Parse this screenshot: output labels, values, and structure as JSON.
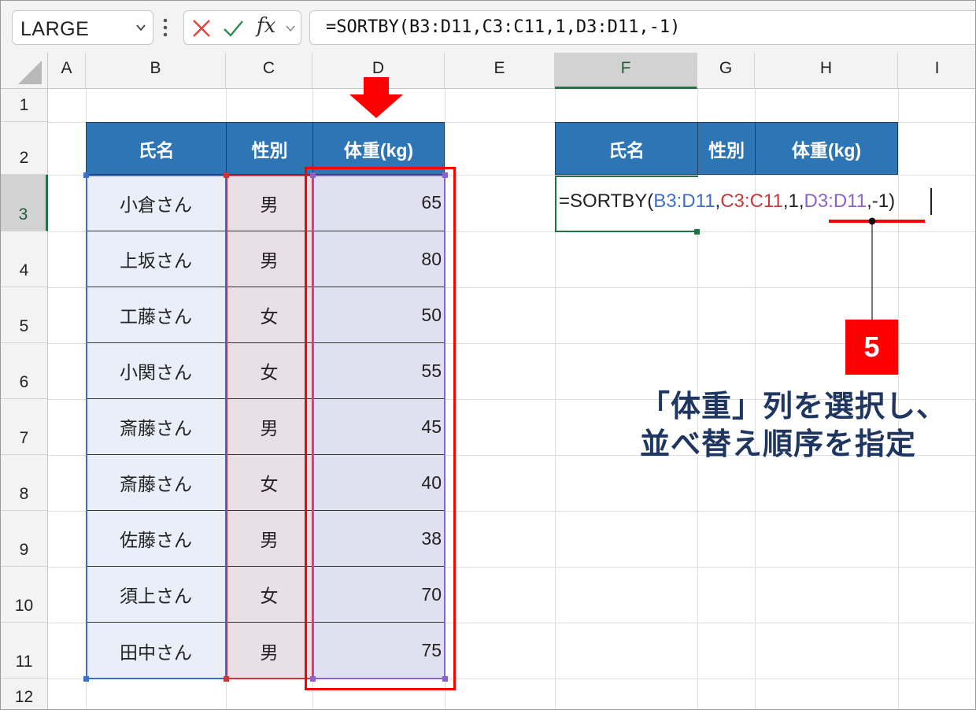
{
  "formula_bar": {
    "name_box": "LARGE",
    "formula": "=SORTBY(B3:D11,C3:C11,1,D3:D11,-1)",
    "fx_label": "fx"
  },
  "columns": [
    "A",
    "B",
    "C",
    "D",
    "E",
    "F",
    "G",
    "H",
    "I"
  ],
  "rows": [
    "1",
    "2",
    "3",
    "4",
    "5",
    "6",
    "7",
    "8",
    "9",
    "10",
    "11",
    "12"
  ],
  "table": {
    "headers": [
      "氏名",
      "性別",
      "体重(kg)"
    ],
    "names": [
      "小倉さん",
      "上坂さん",
      "工藤さん",
      "小関さん",
      "斎藤さん",
      "斎藤さん",
      "佐藤さん",
      "須上さん",
      "田中さん"
    ],
    "genders": [
      "男",
      "男",
      "女",
      "女",
      "男",
      "女",
      "男",
      "女",
      "男"
    ],
    "weights": [
      "65",
      "80",
      "50",
      "55",
      "45",
      "40",
      "38",
      "70",
      "75"
    ]
  },
  "result_table": {
    "headers": [
      "氏名",
      "性別",
      "体重(kg)"
    ]
  },
  "edit": {
    "prefix": "=SORTBY(",
    "arg1": "B3:D11",
    "sep1": ",",
    "arg2": "C3:C11",
    "mid": ",1,",
    "arg3": "D3:D11",
    "suffix": ",-1)"
  },
  "annotation": {
    "step": "5",
    "line1": "「体重」列を選択し、",
    "line2": "並べ替え順序を指定"
  },
  "colors": {
    "header_blue": "#2e75b6",
    "ref_blue": "#3d6ec9",
    "ref_red": "#c8383a",
    "ref_purple": "#8a63c9",
    "excel_green": "#217346",
    "highlight_red": "#ff0000",
    "annotation_navy": "#1f3660"
  }
}
